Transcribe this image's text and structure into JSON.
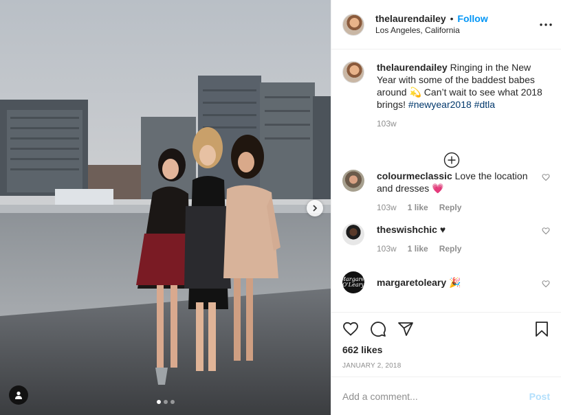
{
  "post": {
    "username": "thelaurendailey",
    "separator": "•",
    "follow_label": "Follow",
    "location": "Los Angeles, California",
    "more_icon": "more-horizontal-icon"
  },
  "caption": {
    "username": "thelaurendailey",
    "text": "Ringing in the New Year with some of the baddest babes around 💫 Can’t wait to see what 2018 brings!",
    "hashtags": [
      "#newyear2018",
      "#dtla"
    ],
    "time": "103w"
  },
  "comments": [
    {
      "username": "colourmeclassic",
      "text": "Love the location and dresses 💗",
      "time": "103w",
      "likes": "1 like",
      "reply": "Reply"
    },
    {
      "username": "theswishchic",
      "text": "♥",
      "time": "103w",
      "likes": "1 like",
      "reply": "Reply"
    },
    {
      "username": "margaretoleary",
      "text": "🎉",
      "avatar_text": "Margaret O'Leary"
    }
  ],
  "stats": {
    "likes": "662 likes",
    "date": "JANUARY 2, 2018"
  },
  "composer": {
    "placeholder": "Add a comment...",
    "post_label": "Post"
  },
  "carousel": {
    "total": 3,
    "active": 1
  },
  "colors": {
    "follow": "#0095f6",
    "hashtag": "#00376b",
    "post_disabled": "#b2dffc",
    "muted": "#8e8e8e"
  }
}
